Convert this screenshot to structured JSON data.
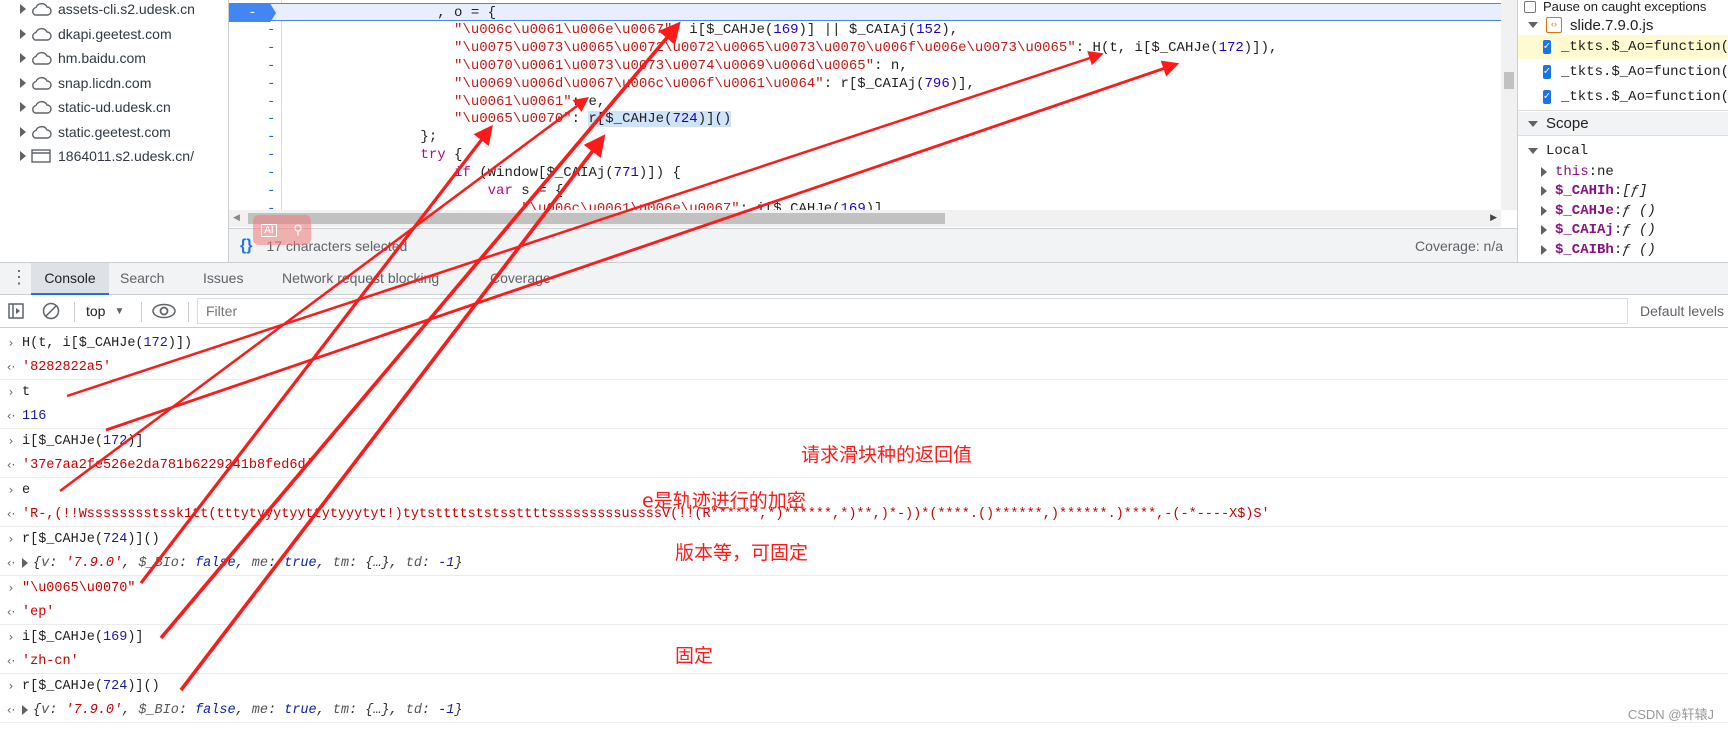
{
  "file_tree": {
    "items": [
      {
        "label": "assets-cli.s2.udesk.cn",
        "icon": "cloud-icon"
      },
      {
        "label": "dkapi.geetest.com",
        "icon": "cloud-icon"
      },
      {
        "label": "hm.baidu.com",
        "icon": "cloud-icon"
      },
      {
        "label": "snap.licdn.com",
        "icon": "cloud-icon"
      },
      {
        "label": "static-ud.udesk.cn",
        "icon": "cloud-icon"
      },
      {
        "label": "static.geetest.com",
        "icon": "cloud-icon"
      },
      {
        "label": "1864011.s2.udesk.cn/",
        "icon": "frame-icon"
      }
    ]
  },
  "editor": {
    "gutter_marker": "-",
    "lines": [
      {
        "paused": true,
        "tokens": [
          {
            "t": "                  , o = {",
            "c": "plain"
          }
        ]
      },
      {
        "tokens": [
          {
            "t": "                    \"\\u006c\\u0061\\u006e\\u0067\"",
            "c": "str"
          },
          {
            "t": ": i[$_CAHJe(",
            "c": "plain"
          },
          {
            "t": "169",
            "c": "num"
          },
          {
            "t": ")] || $_CAIAj(",
            "c": "plain"
          },
          {
            "t": "152",
            "c": "num"
          },
          {
            "t": "),",
            "c": "plain"
          }
        ]
      },
      {
        "tokens": [
          {
            "t": "                    \"\\u0075\\u0073\\u0065\\u0072\\u0072\\u0065\\u0073\\u0070\\u006f\\u006e\\u0073\\u0065\"",
            "c": "str"
          },
          {
            "t": ": H(t, i[$_CAHJe(",
            "c": "plain"
          },
          {
            "t": "172",
            "c": "num"
          },
          {
            "t": ")]),",
            "c": "plain"
          }
        ]
      },
      {
        "tokens": [
          {
            "t": "                    \"\\u0070\\u0061\\u0073\\u0073\\u0074\\u0069\\u006d\\u0065\"",
            "c": "str"
          },
          {
            "t": ": n,",
            "c": "plain"
          }
        ]
      },
      {
        "tokens": [
          {
            "t": "                    \"\\u0069\\u006d\\u0067\\u006c\\u006f\\u0061\\u0064\"",
            "c": "str"
          },
          {
            "t": ": r[$_CAIAj(",
            "c": "plain"
          },
          {
            "t": "796",
            "c": "num"
          },
          {
            "t": ")],",
            "c": "plain"
          }
        ]
      },
      {
        "tokens": [
          {
            "t": "                    \"\\u0061\\u0061\"",
            "c": "str"
          },
          {
            "t": ": e,",
            "c": "plain"
          }
        ]
      },
      {
        "tokens": [
          {
            "t": "                    \"\\u0065\\u0070\"",
            "c": "str"
          },
          {
            "t": ": ",
            "c": "plain"
          },
          {
            "t": "r[$_CAHJe(",
            "c": "plain",
            "sel": true
          },
          {
            "t": "724",
            "c": "num",
            "sel": true
          },
          {
            "t": ")]()",
            "c": "plain",
            "sel": true
          }
        ]
      },
      {
        "tokens": [
          {
            "t": "                };",
            "c": "plain"
          }
        ]
      },
      {
        "tokens": [
          {
            "t": "                ",
            "c": "plain"
          },
          {
            "t": "try",
            "c": "kw"
          },
          {
            "t": " {",
            "c": "plain"
          }
        ]
      },
      {
        "tokens": [
          {
            "t": "                    ",
            "c": "plain"
          },
          {
            "t": "if",
            "c": "kw"
          },
          {
            "t": " (window[$_CAIAj(",
            "c": "plain"
          },
          {
            "t": "771",
            "c": "num"
          },
          {
            "t": ")]) {",
            "c": "plain"
          }
        ]
      },
      {
        "tokens": [
          {
            "t": "                        ",
            "c": "plain"
          },
          {
            "t": "var",
            "c": "kw"
          },
          {
            "t": " s = {",
            "c": "plain"
          }
        ]
      },
      {
        "tokens": [
          {
            "t": "                            \"\\u006c\\u0061\\u006e\\u0067\"",
            "c": "str"
          },
          {
            "t": ": i[$_CAHJe(",
            "c": "plain"
          },
          {
            "t": "169",
            "c": "num"
          },
          {
            "t": ")],",
            "c": "plain"
          }
        ]
      }
    ],
    "status": {
      "selection": "17 characters selected",
      "coverage": "Coverage: n/a"
    }
  },
  "right_panel": {
    "pause_caught": "Pause on caught exceptions",
    "file": "slide.7.9.0.js",
    "breakpoints": [
      "_tkts.$_Ao=function(",
      "_tkts.$_Ao=function(",
      "_tkts.$_Ao=function("
    ],
    "scope_label": "Scope",
    "local_label": "Local",
    "scope_vars": [
      {
        "key": "this",
        "val": "ne",
        "plain": true
      },
      {
        "key": "$_CAHIh",
        "val": "[ƒ]"
      },
      {
        "key": "$_CAHJe",
        "val": "ƒ ()"
      },
      {
        "key": "$_CAIAj",
        "val": "ƒ ()"
      },
      {
        "key": "$_CAIBh",
        "val": "ƒ ()"
      }
    ]
  },
  "drawer": {
    "tabs": [
      "Console",
      "Search",
      "Issues",
      "Network request blocking",
      "Coverage"
    ],
    "active_tab": "Console",
    "context": "top",
    "filter_placeholder": "Filter",
    "levels": "Default levels"
  },
  "console": {
    "entries": [
      {
        "kind": "in",
        "tokens": [
          {
            "t": "H(t, i[$_CAHJe(",
            "c": "plain"
          },
          {
            "t": "172",
            "c": "cnum"
          },
          {
            "t": ")])",
            "c": "plain"
          }
        ]
      },
      {
        "kind": "out",
        "tokens": [
          {
            "t": "'8282822a5'",
            "c": "cstr"
          }
        ]
      },
      {
        "kind": "in",
        "tokens": [
          {
            "t": "t",
            "c": "plain"
          }
        ]
      },
      {
        "kind": "out",
        "tokens": [
          {
            "t": "116",
            "c": "cnum"
          }
        ]
      },
      {
        "kind": "in",
        "tokens": [
          {
            "t": "i[$_CAHJe(",
            "c": "plain"
          },
          {
            "t": "172",
            "c": "cnum"
          },
          {
            "t": ")]",
            "c": "plain"
          }
        ]
      },
      {
        "kind": "out",
        "tokens": [
          {
            "t": "'37e7aa2fe526e2da781b6229241b8fed6d'",
            "c": "cstr"
          }
        ]
      },
      {
        "kind": "in",
        "tokens": [
          {
            "t": "e",
            "c": "plain"
          }
        ]
      },
      {
        "kind": "out",
        "tokens": [
          {
            "t": "'R-,(!!Wsssssssstssk1tt(tttytyyytyyttytyyytyt!)tytsttttststssttttsssssssssussssV(!!(R******,*)******,*)**,)*-))*(****.()******,)******.)****,-(-*----X$)S'",
            "c": "cstr"
          }
        ]
      },
      {
        "kind": "in",
        "tokens": [
          {
            "t": "r[$_CAHJe(",
            "c": "plain"
          },
          {
            "t": "724",
            "c": "cnum"
          },
          {
            "t": ")]()",
            "c": "plain"
          }
        ]
      },
      {
        "kind": "out",
        "expandable": true,
        "tokens": [
          {
            "t": "{",
            "c": "ital"
          },
          {
            "t": "v",
            "c": "ckey"
          },
          {
            "t": ": ",
            "c": "ital"
          },
          {
            "t": "'7.9.0'",
            "c": "cstri"
          },
          {
            "t": ", ",
            "c": "ital"
          },
          {
            "t": "$_BIo",
            "c": "ckey"
          },
          {
            "t": ": ",
            "c": "ital"
          },
          {
            "t": "false",
            "c": "cbool"
          },
          {
            "t": ", ",
            "c": "ital"
          },
          {
            "t": "me",
            "c": "ckey"
          },
          {
            "t": ": ",
            "c": "ital"
          },
          {
            "t": "true",
            "c": "cbool"
          },
          {
            "t": ", ",
            "c": "ital"
          },
          {
            "t": "tm",
            "c": "ckey"
          },
          {
            "t": ": {…}, ",
            "c": "ital"
          },
          {
            "t": "td",
            "c": "ckey"
          },
          {
            "t": ": ",
            "c": "ital"
          },
          {
            "t": "-1",
            "c": "cnumi"
          },
          {
            "t": "}",
            "c": "ital"
          }
        ]
      },
      {
        "kind": "in",
        "tokens": [
          {
            "t": "\"\\u0065\\u0070\"",
            "c": "cstr"
          }
        ]
      },
      {
        "kind": "out",
        "tokens": [
          {
            "t": "'ep'",
            "c": "cstr"
          }
        ]
      },
      {
        "kind": "in",
        "tokens": [
          {
            "t": "i[$_CAHJe(",
            "c": "plain"
          },
          {
            "t": "169",
            "c": "cnum"
          },
          {
            "t": ")]",
            "c": "plain"
          }
        ]
      },
      {
        "kind": "out",
        "tokens": [
          {
            "t": "'zh-cn'",
            "c": "cstr"
          }
        ]
      },
      {
        "kind": "in",
        "tokens": [
          {
            "t": "r[$_CAHJe(",
            "c": "plain"
          },
          {
            "t": "724",
            "c": "cnum"
          },
          {
            "t": ")]()",
            "c": "plain"
          }
        ]
      },
      {
        "kind": "out",
        "expandable": true,
        "tokens": [
          {
            "t": "{",
            "c": "ital"
          },
          {
            "t": "v",
            "c": "ckey"
          },
          {
            "t": ": ",
            "c": "ital"
          },
          {
            "t": "'7.9.0'",
            "c": "cstri"
          },
          {
            "t": ", ",
            "c": "ital"
          },
          {
            "t": "$_BIo",
            "c": "ckey"
          },
          {
            "t": ": ",
            "c": "ital"
          },
          {
            "t": "false",
            "c": "cbool"
          },
          {
            "t": ", ",
            "c": "ital"
          },
          {
            "t": "me",
            "c": "ckey"
          },
          {
            "t": ": ",
            "c": "ital"
          },
          {
            "t": "true",
            "c": "cbool"
          },
          {
            "t": ", ",
            "c": "ital"
          },
          {
            "t": "tm",
            "c": "ckey"
          },
          {
            "t": ": {…}, ",
            "c": "ital"
          },
          {
            "t": "td",
            "c": "ckey"
          },
          {
            "t": ": ",
            "c": "ital"
          },
          {
            "t": "-1",
            "c": "cnumi"
          },
          {
            "t": "}",
            "c": "ital"
          }
        ]
      }
    ]
  },
  "annotations": {
    "slider_return": "请求滑块种的返回值",
    "e_encrypt": "e是轨迹进行的加密",
    "version_fixed": "版本等，可固定",
    "fixed": "固定",
    "arrow_color": "#ff1a1a"
  },
  "watermark": "CSDN @轩辕J"
}
